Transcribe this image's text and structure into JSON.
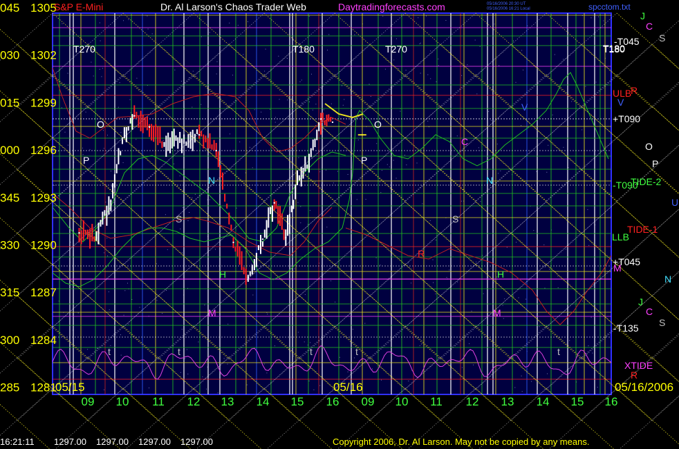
{
  "header": {
    "instrument": "S&P E-Mini",
    "site_title": "Dr. Al Larson's Chaos Trader Web",
    "site_url": "Daytradingforecasts.com",
    "stamp_line1": "05/16/2006 20:30 UT",
    "stamp_line2": "05/16/2006 16:21 Local",
    "file_name": "spcctom.txt"
  },
  "y_axis": {
    "angle_labels": [
      "045",
      "030",
      "015",
      "000",
      "345",
      "330",
      "315",
      "300",
      "285"
    ],
    "price_labels": [
      "1305",
      "1302",
      "1299",
      "1296",
      "1293",
      "1290",
      "1287",
      "1284",
      "1281"
    ]
  },
  "x_axis": {
    "hour_labels": [
      "09",
      "10",
      "11",
      "12",
      "13",
      "14",
      "15",
      "16",
      "09",
      "10",
      "11",
      "12",
      "13",
      "14",
      "15",
      "16"
    ],
    "date_left": "05/15",
    "date_mid": "05/16",
    "date_right": "05/16/2006"
  },
  "chart_data": {
    "type": "line",
    "title": "S&P E-Mini",
    "ylim": [
      1281,
      1305
    ],
    "session_dates": [
      "05/15",
      "05/16"
    ],
    "series": [
      {
        "name": "Price",
        "color": "#ffffff",
        "x": [
          "05/15 08:45",
          "05/15 09:15",
          "05/15 09:40",
          "05/15 10:00",
          "05/15 10:20",
          "05/15 10:45",
          "05/15 11:10",
          "05/15 11:40",
          "05/15 12:10",
          "05/15 12:40",
          "05/15 13:10",
          "05/15 13:35",
          "05/15 14:00",
          "05/15 14:20",
          "05/15 14:40",
          "05/15 15:00",
          "05/15 15:20",
          "05/15 15:40",
          "05/15 16:00",
          "05/16 08:50"
        ],
        "y": [
          1290.8,
          1290.5,
          1292.8,
          1296.8,
          1298.2,
          1297.5,
          1296.5,
          1296.6,
          1297.0,
          1296.0,
          1290.2,
          1288.0,
          1290.4,
          1292.7,
          1290.5,
          1294.0,
          1295.5,
          1298.0,
          1297.8,
          1297.0
        ]
      }
    ],
    "curve_labels_left": [
      "O",
      "P",
      "N",
      "S",
      "H",
      "M"
    ],
    "curve_labels_right": [
      "O",
      "P",
      "N",
      "S",
      "H",
      "M",
      "C",
      "V",
      "R"
    ],
    "bottom_marks": [
      "t",
      "t",
      "t",
      "t",
      "t"
    ],
    "left_session_top_labels": [
      "T270",
      "T180"
    ],
    "right_session_top_labels": [
      "T270",
      "T180"
    ],
    "right_margin_labels": [
      {
        "text": "J",
        "color": "#40ff40"
      },
      {
        "text": "C",
        "color": "#ff40ff"
      },
      {
        "text": "S",
        "color": "#c0c0c0"
      },
      {
        "text": "-T045",
        "color": "#ffffff"
      },
      {
        "text": "T180",
        "color": "#ffffff"
      },
      {
        "text": "ULB",
        "color": "#ff2020"
      },
      {
        "text": "R",
        "color": "#ff2020"
      },
      {
        "text": "V",
        "color": "#4060ff"
      },
      {
        "text": "+T090",
        "color": "#ffffff"
      },
      {
        "text": "O",
        "color": "#ffffff"
      },
      {
        "text": "P",
        "color": "#ffffff"
      },
      {
        "text": "-T090",
        "color": "#40ff40"
      },
      {
        "text": "TIDE-2",
        "color": "#40ff40"
      },
      {
        "text": "U",
        "color": "#4060ff"
      },
      {
        "text": "TIDE-1",
        "color": "#ff2020"
      },
      {
        "text": "LLB",
        "color": "#40ff40"
      },
      {
        "text": "+T045",
        "color": "#ffffff"
      },
      {
        "text": "M",
        "color": "#ff40ff"
      },
      {
        "text": "N",
        "color": "#40e0ff"
      },
      {
        "text": "J",
        "color": "#40ff40"
      },
      {
        "text": "C",
        "color": "#ff40ff"
      },
      {
        "text": "S",
        "color": "#c0c0c0"
      },
      {
        "text": "-T135",
        "color": "#ffffff"
      },
      {
        "text": "XTIDE",
        "color": "#ff40ff"
      },
      {
        "text": "R",
        "color": "#ff2020"
      }
    ]
  },
  "status": {
    "time": "16:21:11",
    "open": "1297.00",
    "high": "1297.00",
    "low": "1297.00",
    "close": "1297.00"
  },
  "copyright": "Copyright 2006, Dr. Al Larson. May not be copied by any means.",
  "colors": {
    "plot_bg": "#000040",
    "frame": "#3030ff",
    "grid_yellow": "#e8e020",
    "grid_green": "#20c020",
    "price_white": "#ffffff",
    "price_red": "#ff2020",
    "tide_green": "#40ff40",
    "xtide_magenta": "#e040e0"
  }
}
